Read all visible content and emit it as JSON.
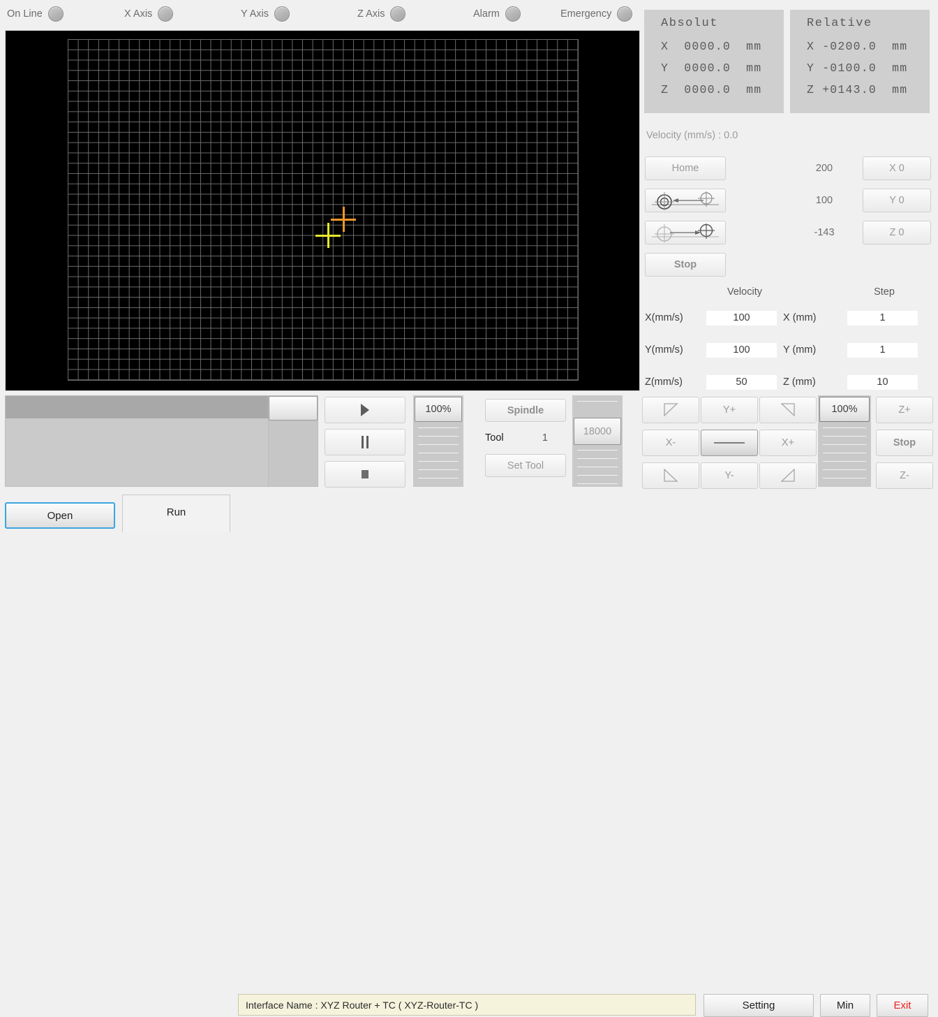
{
  "status_leds": [
    {
      "label": "On Line",
      "name": "online"
    },
    {
      "label": "X Axis",
      "name": "x-axis"
    },
    {
      "label": "Y Axis",
      "name": "y-axis"
    },
    {
      "label": "Z Axis",
      "name": "z-axis"
    },
    {
      "label": "Alarm",
      "name": "alarm"
    },
    {
      "label": "Emergency",
      "name": "emergency"
    }
  ],
  "dro": {
    "absolute": {
      "title": "Absolut",
      "rows": [
        {
          "axis": "X",
          "value": "0000.0",
          "unit": "mm",
          "text": "X  0000.0  mm"
        },
        {
          "axis": "Y",
          "value": "0000.0",
          "unit": "mm",
          "text": "Y  0000.0  mm"
        },
        {
          "axis": "Z",
          "value": "0000.0",
          "unit": "mm",
          "text": "Z  0000.0  mm"
        }
      ]
    },
    "relative": {
      "title": "Relative",
      "rows": [
        {
          "axis": "X",
          "value": "-0200.0",
          "unit": "mm",
          "text": "X -0200.0  mm"
        },
        {
          "axis": "Y",
          "value": "-0100.0",
          "unit": "mm",
          "text": "Y -0100.0  mm"
        },
        {
          "axis": "Z",
          "value": "+0143.0",
          "unit": "mm",
          "text": "Z +0143.0  mm"
        }
      ]
    }
  },
  "velocity_readout": "Velocity (mm/s) : 0.0",
  "home_column": {
    "home_label": "Home",
    "goto_home_icon": "goto-home-icon",
    "goto_work_icon": "goto-work-icon",
    "stop_label": "Stop"
  },
  "position_numbers": [
    "200",
    "100",
    "-143"
  ],
  "zero_buttons": [
    "X 0",
    "Y 0",
    "Z 0"
  ],
  "velocity_step_table": {
    "headers": {
      "velocity": "Velocity",
      "step": "Step"
    },
    "rows": [
      {
        "vel_label": "X(mm/s)",
        "vel_value": "100",
        "step_label": "X (mm)",
        "step_value": "1"
      },
      {
        "vel_label": "Y(mm/s)",
        "vel_value": "100",
        "step_label": "Y (mm)",
        "step_value": "1"
      },
      {
        "vel_label": "Z(mm/s)",
        "vel_value": "50",
        "step_label": "Z (mm)",
        "step_value": "10"
      }
    ]
  },
  "playback": {
    "play_icon": "play-icon",
    "pause_icon": "pause-icon",
    "stop_icon": "stop-square-icon"
  },
  "feed_override": {
    "value": "100%"
  },
  "spindle": {
    "spindle_label": "Spindle",
    "tool_label": "Tool",
    "tool_value": "1",
    "set_tool_label": "Set Tool",
    "rpm_value": "18000"
  },
  "jogpad": {
    "up_left": "",
    "y_plus": "Y+",
    "up_right": "",
    "x_minus": "X-",
    "center": "",
    "x_plus": "X+",
    "down_left": "",
    "y_minus": "Y-",
    "down_right": "",
    "z_plus": "Z+",
    "stop": "Stop",
    "z_minus": "Z-",
    "override": "100%"
  },
  "bottom": {
    "open_label": "Open",
    "run_label": "Run",
    "interface_name": "Interface Name : XYZ Router + TC ( XYZ-Router-TC )",
    "setting_label": "Setting",
    "min_label": "Min",
    "exit_label": "Exit"
  },
  "colors": {
    "tool_crosshair": "#e8e82a",
    "origin_crosshair": "#f0962a",
    "exit_text": "#ee2020",
    "focus_border": "#3ba5e0",
    "canvas_bg": "#000000",
    "grid_line": "#6d6d6d",
    "info_bg": "#f5f3dc"
  }
}
